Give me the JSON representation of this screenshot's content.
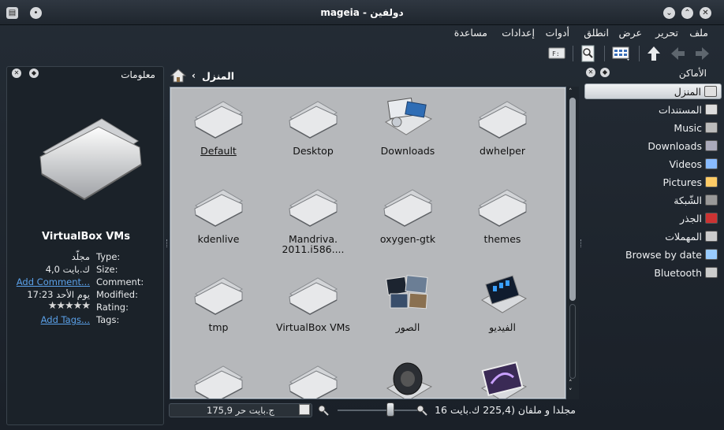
{
  "window": {
    "title": "mageia - دولفين"
  },
  "menu": [
    "ملف",
    "تحرير",
    "عرض",
    "انطلق",
    "أدوات",
    "إعدادات",
    "مساعدة"
  ],
  "breadcrumb": {
    "current": "المنزل"
  },
  "places": {
    "title": "الأماكن",
    "items": [
      {
        "label": "المنزل",
        "icon": "home-icon",
        "selected": true
      },
      {
        "label": "المستندات",
        "icon": "documents-icon"
      },
      {
        "label": "Music",
        "icon": "music-icon"
      },
      {
        "label": "Downloads",
        "icon": "downloads-icon"
      },
      {
        "label": "Videos",
        "icon": "videos-icon"
      },
      {
        "label": "Pictures",
        "icon": "pictures-icon"
      },
      {
        "label": "الشّبكة",
        "icon": "network-icon"
      },
      {
        "label": "الجذر",
        "icon": "root-icon"
      },
      {
        "label": "المهملات",
        "icon": "trash-icon"
      },
      {
        "label": "Browse by date",
        "icon": "calendar-icon"
      },
      {
        "label": "Bluetooth",
        "icon": "bluetooth-icon"
      }
    ]
  },
  "info": {
    "title": "معلومات",
    "name": "VirtualBox VMs",
    "rows": [
      {
        "label": "Type:",
        "value": "مجلّد"
      },
      {
        "label": "Size:",
        "value": "4,0 ك.بايت"
      },
      {
        "label": "Comment:",
        "value": "Add Comment...",
        "link": true
      },
      {
        "label": "Modified:",
        "value": "يوم الأحد 17:23"
      },
      {
        "label": "Rating:",
        "value": "",
        "rating": 5
      },
      {
        "label": "Tags:",
        "value": "Add Tags...",
        "link": true
      }
    ]
  },
  "files": [
    {
      "name": "Default",
      "icon": "folder-icon"
    },
    {
      "name": "Desktop",
      "icon": "folder-icon"
    },
    {
      "name": "Downloads",
      "icon": "downloads-folder-icon"
    },
    {
      "name": "dwhelper",
      "icon": "folder-icon"
    },
    {
      "name": "kdenlive",
      "icon": "folder-icon"
    },
    {
      "name": "Mandriva.\n2011.i586....",
      "icon": "folder-icon"
    },
    {
      "name": "oxygen-gtk",
      "icon": "folder-icon"
    },
    {
      "name": "themes",
      "icon": "folder-icon"
    },
    {
      "name": "tmp",
      "icon": "folder-icon"
    },
    {
      "name": "VirtualBox VMs",
      "icon": "folder-icon"
    },
    {
      "name": "الصور",
      "icon": "pictures-folder-icon"
    },
    {
      "name": "الفيديو",
      "icon": "videos-folder-icon"
    },
    {
      "name": "",
      "icon": "folder-icon"
    },
    {
      "name": "",
      "icon": "folder-icon"
    },
    {
      "name": "",
      "icon": "music-folder-icon"
    },
    {
      "name": "",
      "icon": "image-folder-icon"
    }
  ],
  "status": {
    "free_space": "175,9 ج.بايت حر",
    "count": "16 مجلدا و ملفان (225,4 ك.بايت"
  }
}
